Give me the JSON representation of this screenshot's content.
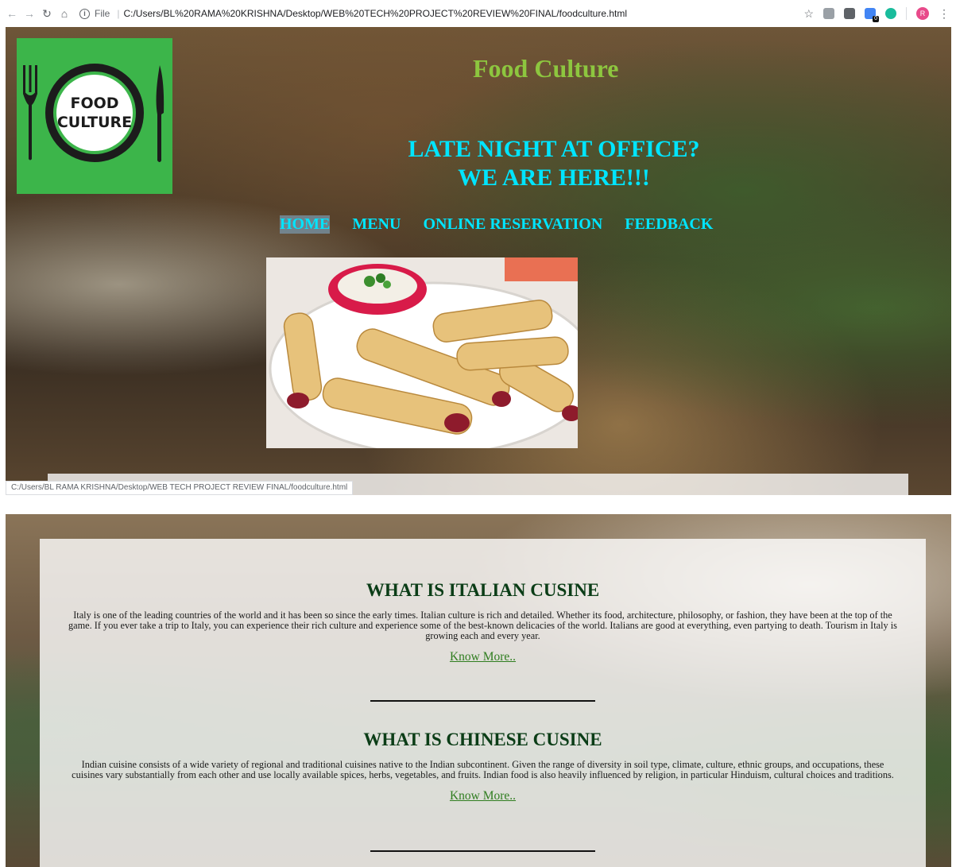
{
  "browser": {
    "file_label": "File",
    "url": "C:/Users/BL%20RAMA%20KRISHNA/Desktop/WEB%20TECH%20PROJECT%20REVIEW%20FINAL/foodculture.html",
    "status_url": "C:/Users/BL RAMA KRISHNA/Desktop/WEB TECH PROJECT REVIEW FINAL/foodculture.html",
    "avatar_letter": "R",
    "icons": [
      "back-arrow-icon",
      "forward-arrow-icon",
      "reload-icon",
      "home-icon",
      "info-icon",
      "star-icon",
      "extension-icon",
      "menu-dots-icon"
    ]
  },
  "header": {
    "logo_line1": "FOOD",
    "logo_line2": "CULTURE",
    "site_title": "Food Culture",
    "tagline_line1": "LATE NIGHT AT OFFICE?",
    "tagline_line2": "WE ARE HERE!!!"
  },
  "nav": {
    "items": [
      {
        "label": "HOME",
        "active": true
      },
      {
        "label": "MENU",
        "active": false
      },
      {
        "label": "ONLINE RESERVATION",
        "active": false
      },
      {
        "label": "FEEDBACK",
        "active": false
      }
    ]
  },
  "sections": [
    {
      "heading": "WHAT IS ITALIAN CUSINE",
      "body": "Italy is one of the leading countries of the world and it has been so since the early times. Italian culture is rich and detailed. Whether its food, architecture, philosophy, or fashion, they have been at the top of the game. If you ever take a trip to Italy, you can experience their rich culture and experience some of the best-known delicacies of the world. Italians are good at everything, even partying to death. Tourism in Italy is growing each and every year.",
      "link": "Know More.."
    },
    {
      "heading": "WHAT IS CHINESE CUSINE",
      "body": "Indian cuisine consists of a wide variety of regional and traditional cuisines native to the Indian subcontinent. Given the range of diversity in soil type, climate, culture, ethnic groups, and occupations, these cuisines vary substantially from each other and use locally available spices, herbs, vegetables, and fruits. Indian food is also heavily influenced by religion, in particular Hinduism, cultural choices and traditions.",
      "link": "Know More.."
    }
  ],
  "colors": {
    "title_green": "#8dc63f",
    "accent_cyan": "#00e5ff",
    "logo_green": "#3cb54a",
    "heading_dark_green": "#0b3d17",
    "link_green": "#2f7d1f"
  }
}
